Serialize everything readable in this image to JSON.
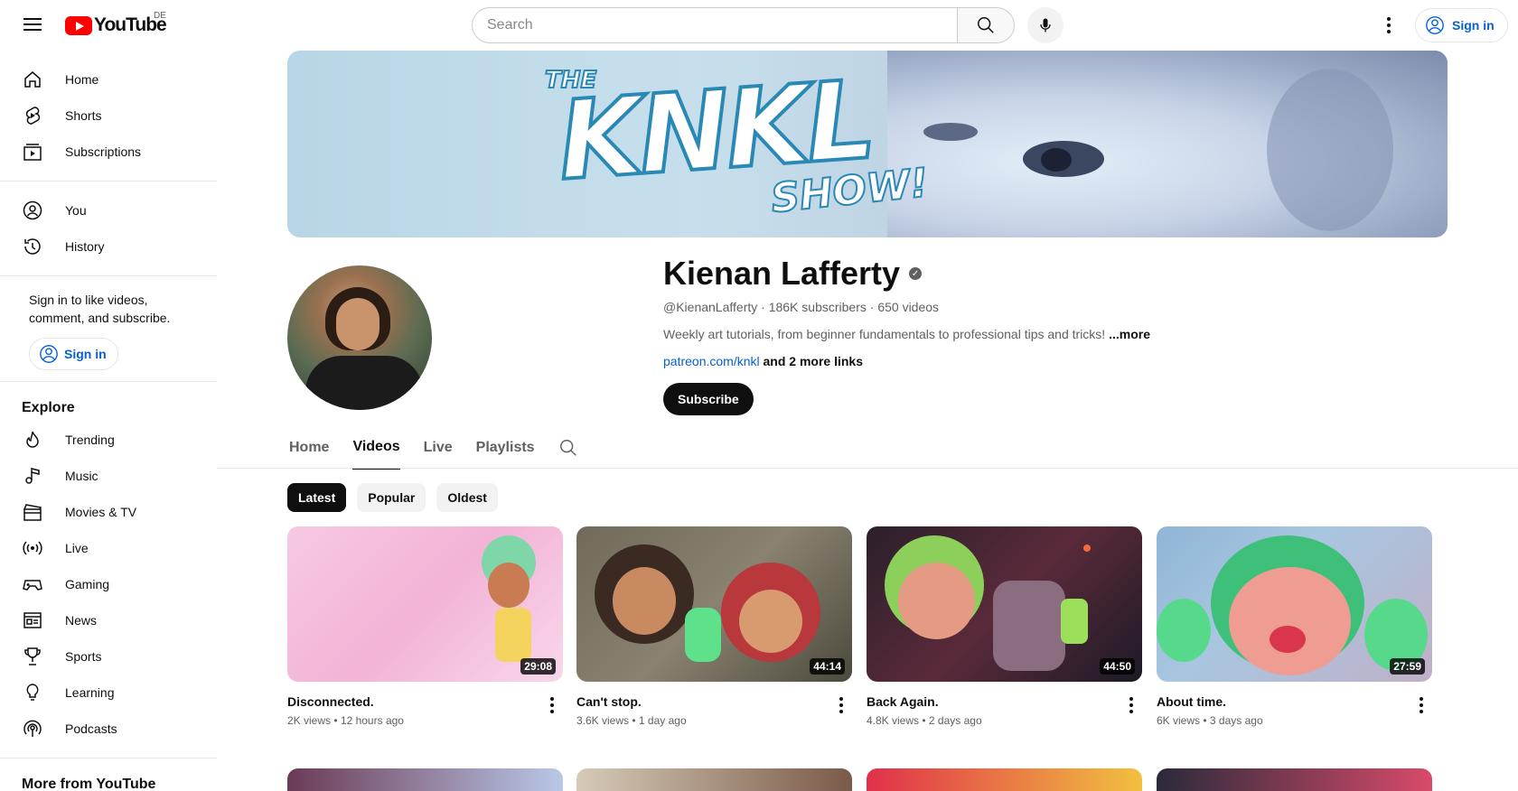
{
  "topbar": {
    "logo_text": "YouTube",
    "region": "DE",
    "search_placeholder": "Search",
    "sign_in": "Sign in"
  },
  "sidebar": {
    "primary": [
      {
        "label": "Home",
        "icon": "home-icon"
      },
      {
        "label": "Shorts",
        "icon": "shorts-icon"
      },
      {
        "label": "Subscriptions",
        "icon": "subscriptions-icon"
      }
    ],
    "you": [
      {
        "label": "You",
        "icon": "you-icon"
      },
      {
        "label": "History",
        "icon": "history-icon"
      }
    ],
    "signin_message": "Sign in to like videos, comment, and subscribe.",
    "signin_button": "Sign in",
    "explore_title": "Explore",
    "explore": [
      {
        "label": "Trending",
        "icon": "trending-icon"
      },
      {
        "label": "Music",
        "icon": "music-icon"
      },
      {
        "label": "Movies & TV",
        "icon": "movies-icon"
      },
      {
        "label": "Live",
        "icon": "live-icon"
      },
      {
        "label": "Gaming",
        "icon": "gaming-icon"
      },
      {
        "label": "News",
        "icon": "news-icon"
      },
      {
        "label": "Sports",
        "icon": "sports-icon"
      },
      {
        "label": "Learning",
        "icon": "learning-icon"
      },
      {
        "label": "Podcasts",
        "icon": "podcasts-icon"
      }
    ],
    "more_title": "More from YouTube"
  },
  "channel": {
    "banner_title": "KNKL",
    "banner_the": "THE",
    "banner_show": "SHOW!",
    "name": "Kienan Lafferty",
    "handle": "@KienanLafferty",
    "subscribers": "186K subscribers",
    "videos_count": "650 videos",
    "description": "Weekly art tutorials, from beginner fundamentals to professional tips and tricks!",
    "more": "...more",
    "link": "patreon.com/knkl",
    "more_links": "and 2 more links",
    "subscribe": "Subscribe"
  },
  "tabs": [
    "Home",
    "Videos",
    "Live",
    "Playlists"
  ],
  "active_tab": "Videos",
  "chips": [
    "Latest",
    "Popular",
    "Oldest"
  ],
  "active_chip": "Latest",
  "videos": [
    {
      "title": "Disconnected.",
      "views": "2K views",
      "age": "12 hours ago",
      "duration": "29:08"
    },
    {
      "title": "Can't stop.",
      "views": "3.6K views",
      "age": "1 day ago",
      "duration": "44:14"
    },
    {
      "title": "Back Again.",
      "views": "4.8K views",
      "age": "2 days ago",
      "duration": "44:50"
    },
    {
      "title": "About time.",
      "views": "6K views",
      "age": "3 days ago",
      "duration": "27:59"
    }
  ],
  "colors": {
    "brand_red": "#ff0000",
    "link_blue": "#065fd4",
    "text_primary": "#0f0f0f",
    "text_secondary": "#606060"
  }
}
